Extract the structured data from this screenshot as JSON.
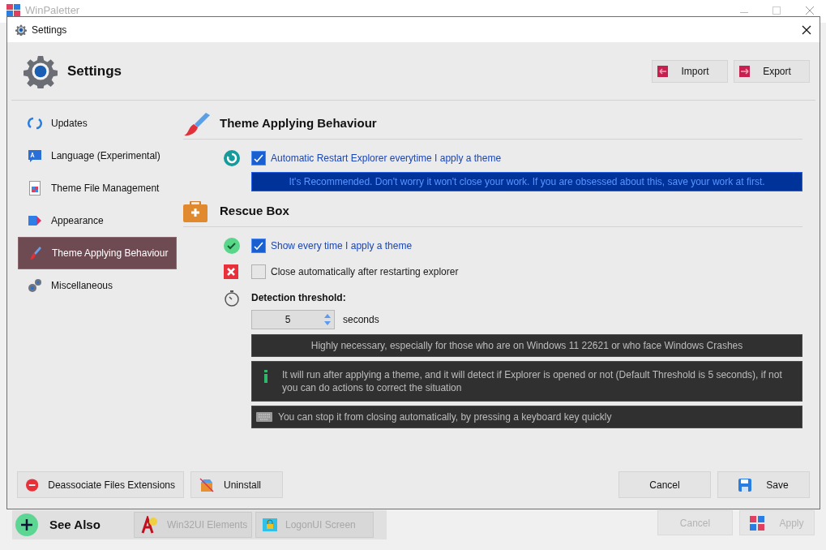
{
  "app_window": {
    "title": "WinPaletter"
  },
  "dialog": {
    "title": "Settings",
    "heading": "Settings",
    "header_buttons": [
      "Import",
      "Export"
    ],
    "sidebar": {
      "items": [
        {
          "label": "Updates",
          "selected": false
        },
        {
          "label": "Language (Experimental)",
          "selected": false
        },
        {
          "label": "Theme File Management",
          "selected": false
        },
        {
          "label": "Appearance",
          "selected": false
        },
        {
          "label": "Theme Applying Behaviour",
          "selected": true
        },
        {
          "label": "Miscellaneous",
          "selected": false
        }
      ]
    },
    "sections": [
      {
        "title": "Theme Applying Behaviour",
        "rows": [
          {
            "kind": "checkbox",
            "label": "Automatic Restart Explorer everytime I apply a theme",
            "checked": true
          },
          {
            "kind": "banner",
            "text": "It's Recommended. Don't worry it won't close your work. If you are obsessed about this, save your work at first."
          }
        ]
      },
      {
        "title": "Rescue Box",
        "rows": [
          {
            "kind": "checkbox",
            "label": "Show every time I apply a theme",
            "checked": true
          },
          {
            "kind": "checkbox",
            "label": "Close automatically after restarting explorer",
            "checked": false
          },
          {
            "kind": "threshold",
            "label": "Detection threshold:",
            "value": "5",
            "unit": "seconds"
          },
          {
            "kind": "note",
            "text": "Highly necessary, especially for those who are on Windows 11 22621 or who face Windows Crashes"
          },
          {
            "kind": "info",
            "text": "It will run after applying a theme, and it will detect if Explorer is opened or not (Default Threshold is 5 seconds), if not you can do actions to correct the situation"
          },
          {
            "kind": "keyboard",
            "text": "You can stop it from closing automatically, by pressing a keyboard key quickly"
          }
        ]
      }
    ],
    "footer_left": [
      "Deassociate Files Extensions",
      "Uninstall"
    ],
    "footer_right": [
      "Cancel",
      "Save"
    ]
  },
  "see_also": {
    "title": "See Also",
    "buttons": [
      "Win32UI Elements",
      "LogonUI Screen"
    ]
  },
  "app_buttons": [
    "Cancel",
    "Apply"
  ]
}
